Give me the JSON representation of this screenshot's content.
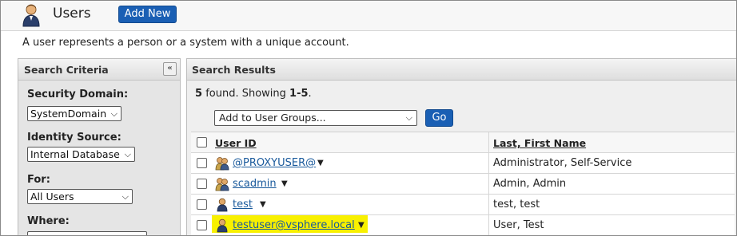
{
  "header": {
    "title": "Users",
    "add_new_label": "Add New"
  },
  "description": "A user represents a person or a system with a unique account.",
  "search_criteria": {
    "title": "Search Criteria",
    "collapse_icon": "double-chevron-left-icon",
    "security_domain_label": "Security Domain:",
    "security_domain_value": "SystemDomain",
    "identity_source_label": "Identity Source:",
    "identity_source_value": "Internal Database",
    "for_label": "For:",
    "for_value": "All Users",
    "where_label": "Where:"
  },
  "search_results": {
    "title": "Search Results",
    "count": "5",
    "found_text": "found. Showing",
    "range": "1-5",
    "groups_placeholder": "Add to User Groups...",
    "go_label": "Go",
    "columns": {
      "user_id": "User ID",
      "name": "Last, First Name"
    },
    "rows": [
      {
        "user_id": "@PROXYUSER@",
        "name": "Administrator, Self-Service",
        "icon": "admin-user-icon",
        "highlighted": false
      },
      {
        "user_id": "scadmin",
        "name": "Admin, Admin",
        "icon": "admin-user-icon",
        "highlighted": false
      },
      {
        "user_id": "test",
        "name": "test, test",
        "icon": "user-icon",
        "highlighted": false
      },
      {
        "user_id": "testuser@vsphere.local",
        "name": "User, Test",
        "icon": "user-icon",
        "highlighted": true
      }
    ]
  },
  "colors": {
    "accent": "#1a5fb4",
    "link": "#1a5a9c",
    "highlight": "#f8f000"
  }
}
